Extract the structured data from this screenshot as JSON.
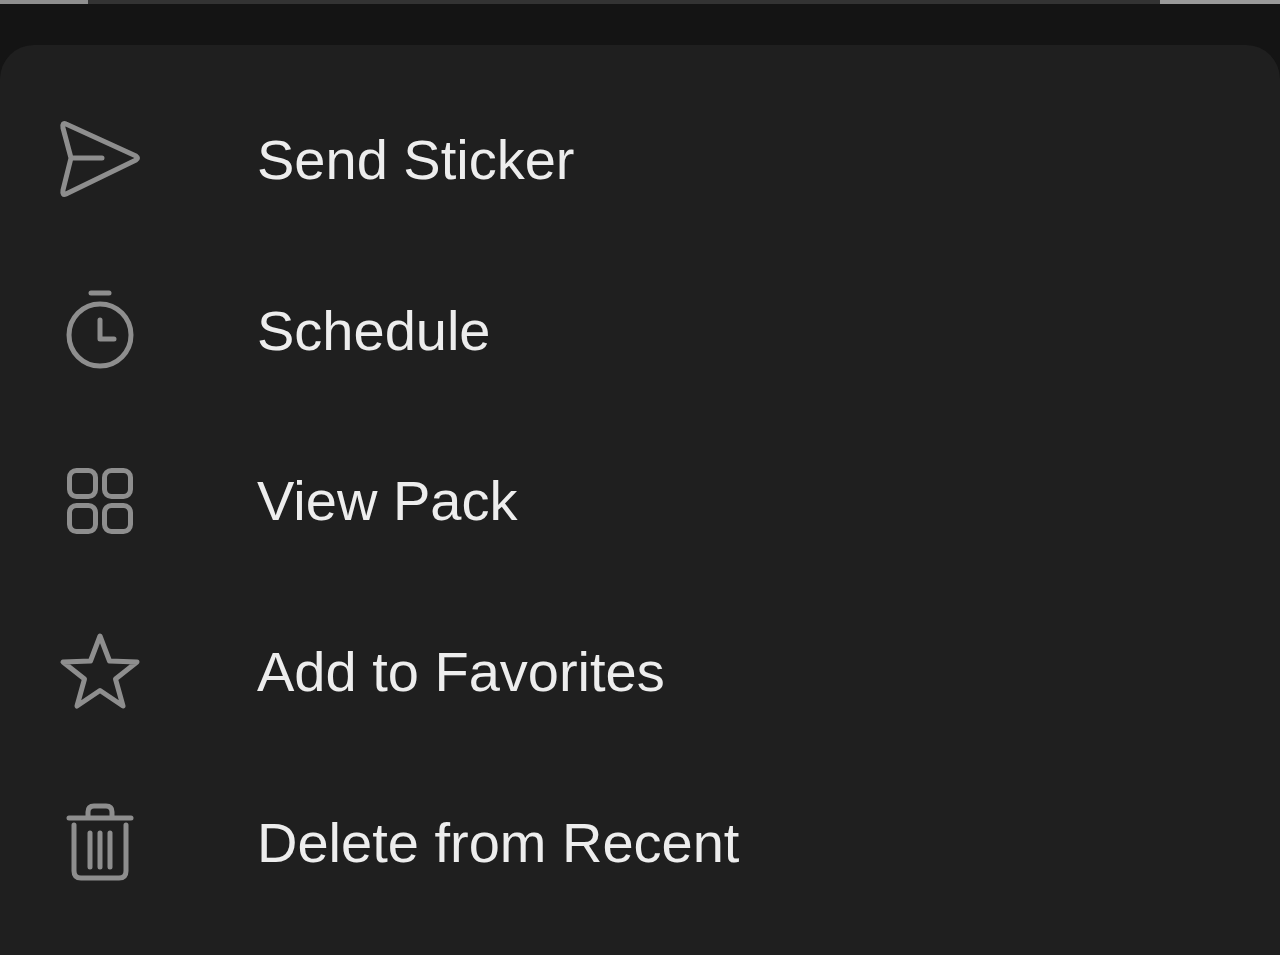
{
  "menu": {
    "items": [
      {
        "kind": "send",
        "label": "Send Sticker"
      },
      {
        "kind": "schedule",
        "label": "Schedule"
      },
      {
        "kind": "pack",
        "label": "View Pack"
      },
      {
        "kind": "favorite",
        "label": "Add to Favorites"
      },
      {
        "kind": "delete",
        "label": "Delete from Recent"
      }
    ]
  }
}
